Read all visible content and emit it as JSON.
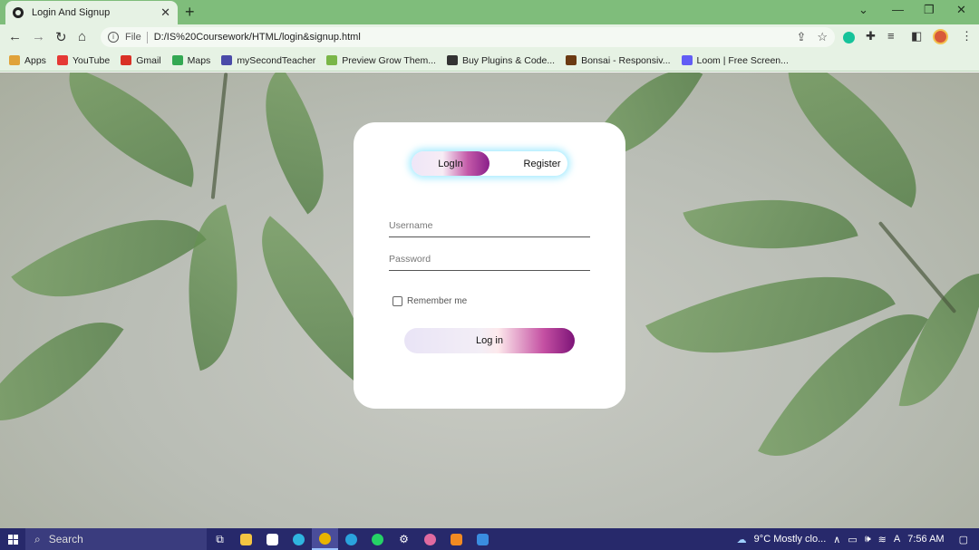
{
  "browser": {
    "tab_title": "Login And Signup",
    "url_scheme_label": "File",
    "url": "D:/IS%20Coursework/HTML/login&signup.html",
    "bookmarks": [
      {
        "label": "Apps",
        "color": "#e0a23a"
      },
      {
        "label": "YouTube",
        "color": "#e53935"
      },
      {
        "label": "Gmail",
        "color": "#d93025"
      },
      {
        "label": "Maps",
        "color": "#34a853"
      },
      {
        "label": "mySecondTeacher",
        "color": "#4a4aa8"
      },
      {
        "label": "Preview Grow Them...",
        "color": "#7ab648"
      },
      {
        "label": "Buy Plugins & Code...",
        "color": "#333333"
      },
      {
        "label": "Bonsai - Responsiv...",
        "color": "#6b3a12"
      },
      {
        "label": "Loom | Free Screen...",
        "color": "#625df5"
      }
    ]
  },
  "form": {
    "toggle_login": "LogIn",
    "toggle_register": "Register",
    "username_placeholder": "Username",
    "password_placeholder": "Password",
    "remember_label": "Remember me",
    "submit_label": "Log in"
  },
  "taskbar": {
    "search_label": "Search",
    "weather": "9°C  Mostly clo...",
    "time": "7:56 AM"
  },
  "colors": {
    "chrome_green": "#7fbd7b",
    "accent_purple": "#8a1f8a",
    "glow_cyan": "#8ce6ff",
    "taskbar": "#27296b"
  }
}
